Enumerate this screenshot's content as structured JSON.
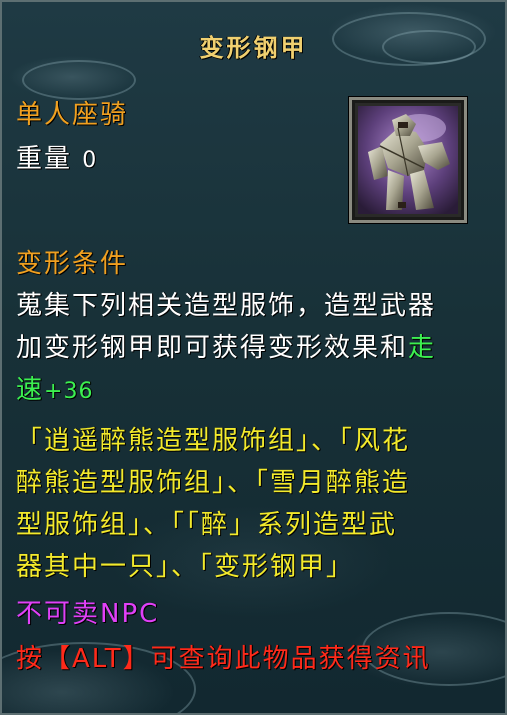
{
  "item": {
    "title": "变形钢甲",
    "type": "单人座骑",
    "weight_label": "重量",
    "weight_value": "0",
    "section_title": "变形条件",
    "desc_line1": "蒐集下列相关造型服饰，造型武器",
    "desc_line2a": "加变形钢甲即可获得变形效果和",
    "desc_line2b": "走",
    "desc_line3a": "速",
    "desc_line3b": "+36",
    "sets_line1": "「逍遥醉熊造型服饰组」、「风花",
    "sets_line2": "醉熊造型服饰组」、「雪月醉熊造",
    "sets_line3": "型服饰组」、「「醉」系列造型武",
    "sets_line4": "器其中一只」、「变形钢甲」",
    "sell_note": "不可卖NPC",
    "alt_hint": "按【ALT】可查询此物品获得资讯"
  },
  "icons": {
    "item_icon": "mech-armor-icon"
  },
  "colors": {
    "title": "#f0d070",
    "label_orange": "#f0a020",
    "text_white": "#ffffff",
    "text_yellow": "#f3ea2c",
    "bonus_green": "#3cf050",
    "note_magenta": "#e040f8",
    "hint_red": "#ff2a1a"
  }
}
